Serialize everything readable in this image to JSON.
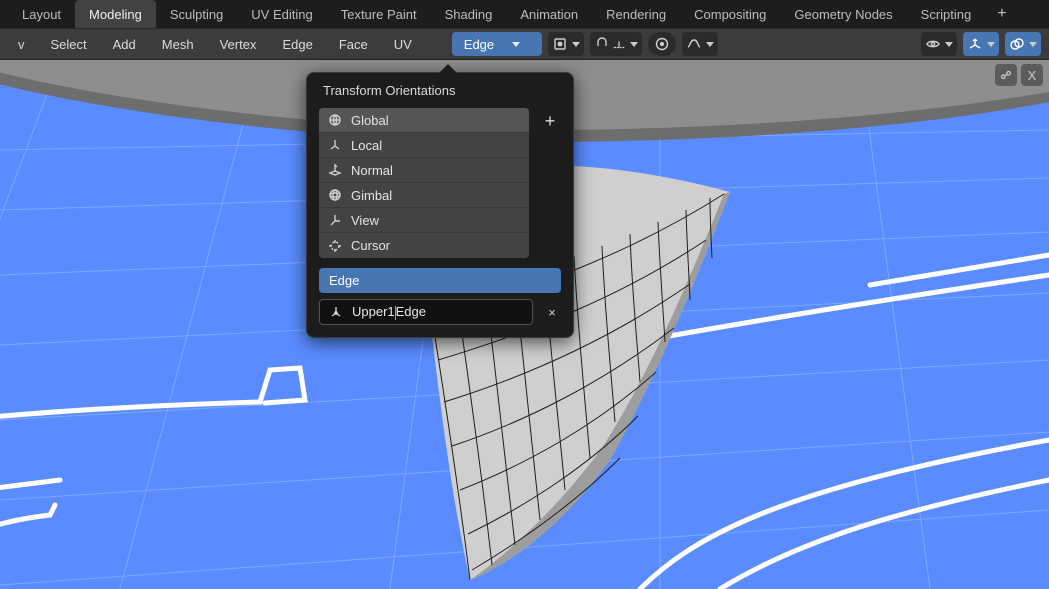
{
  "workspaces": {
    "tabs": [
      "Layout",
      "Modeling",
      "Sculpting",
      "UV Editing",
      "Texture Paint",
      "Shading",
      "Animation",
      "Rendering",
      "Compositing",
      "Geometry Nodes",
      "Scripting"
    ],
    "active": "Modeling"
  },
  "toolbar": {
    "menus_left": [
      "v",
      "Select",
      "Add",
      "Mesh",
      "Vertex",
      "Edge",
      "Face",
      "UV"
    ],
    "transform_orientation_dropdown": "Edge",
    "icons": {
      "pivot": "pivot-icon",
      "snap": "snap-icon",
      "proportional": "proportional-edit-icon",
      "waveform": "waveform-icon",
      "visibility": "visibility-eye-icon",
      "gizmo": "gizmo-icon",
      "overlays": "overlays-icon"
    }
  },
  "viewport_corner": {
    "gizmo_hint": "gizmo-hint-icon",
    "close": "X"
  },
  "popover": {
    "title": "Transform Orientations",
    "items": [
      {
        "label": "Global",
        "icon": "global-orientation-icon"
      },
      {
        "label": "Local",
        "icon": "local-orientation-icon"
      },
      {
        "label": "Normal",
        "icon": "normal-orientation-icon"
      },
      {
        "label": "Gimbal",
        "icon": "gimbal-orientation-icon"
      },
      {
        "label": "View",
        "icon": "view-orientation-icon"
      },
      {
        "label": "Cursor",
        "icon": "cursor-orientation-icon"
      }
    ],
    "add": "+",
    "active_label": "Edge",
    "rename_value": "Upper1Edge",
    "rename_caret_after": "Upper1",
    "rename_caret_before_end": "Edge",
    "remove": "×"
  },
  "colors": {
    "accent": "#4776b3",
    "panel_bg": "#1c1c1c",
    "viewport_blueprint": "#5a8cff"
  }
}
